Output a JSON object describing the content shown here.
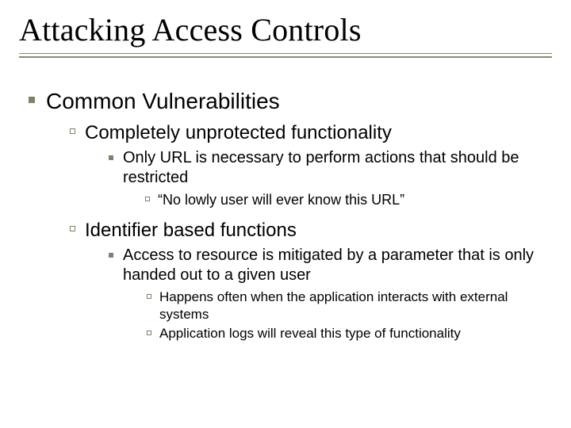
{
  "title": "Attacking Access Controls",
  "h1": "Common Vulnerabilities",
  "sec1": {
    "heading": "Completely unprotected functionality",
    "p1": "Only URL is necessary to perform actions that should be restricted",
    "q1": "“No lowly user will ever know this URL”"
  },
  "sec2": {
    "heading": "Identifier based functions",
    "p1": "Access to resource is mitigated by a parameter that is only handed out to a given user",
    "s1": "Happens often when the application interacts with external systems",
    "s2": "Application logs will reveal this type of functionality"
  }
}
